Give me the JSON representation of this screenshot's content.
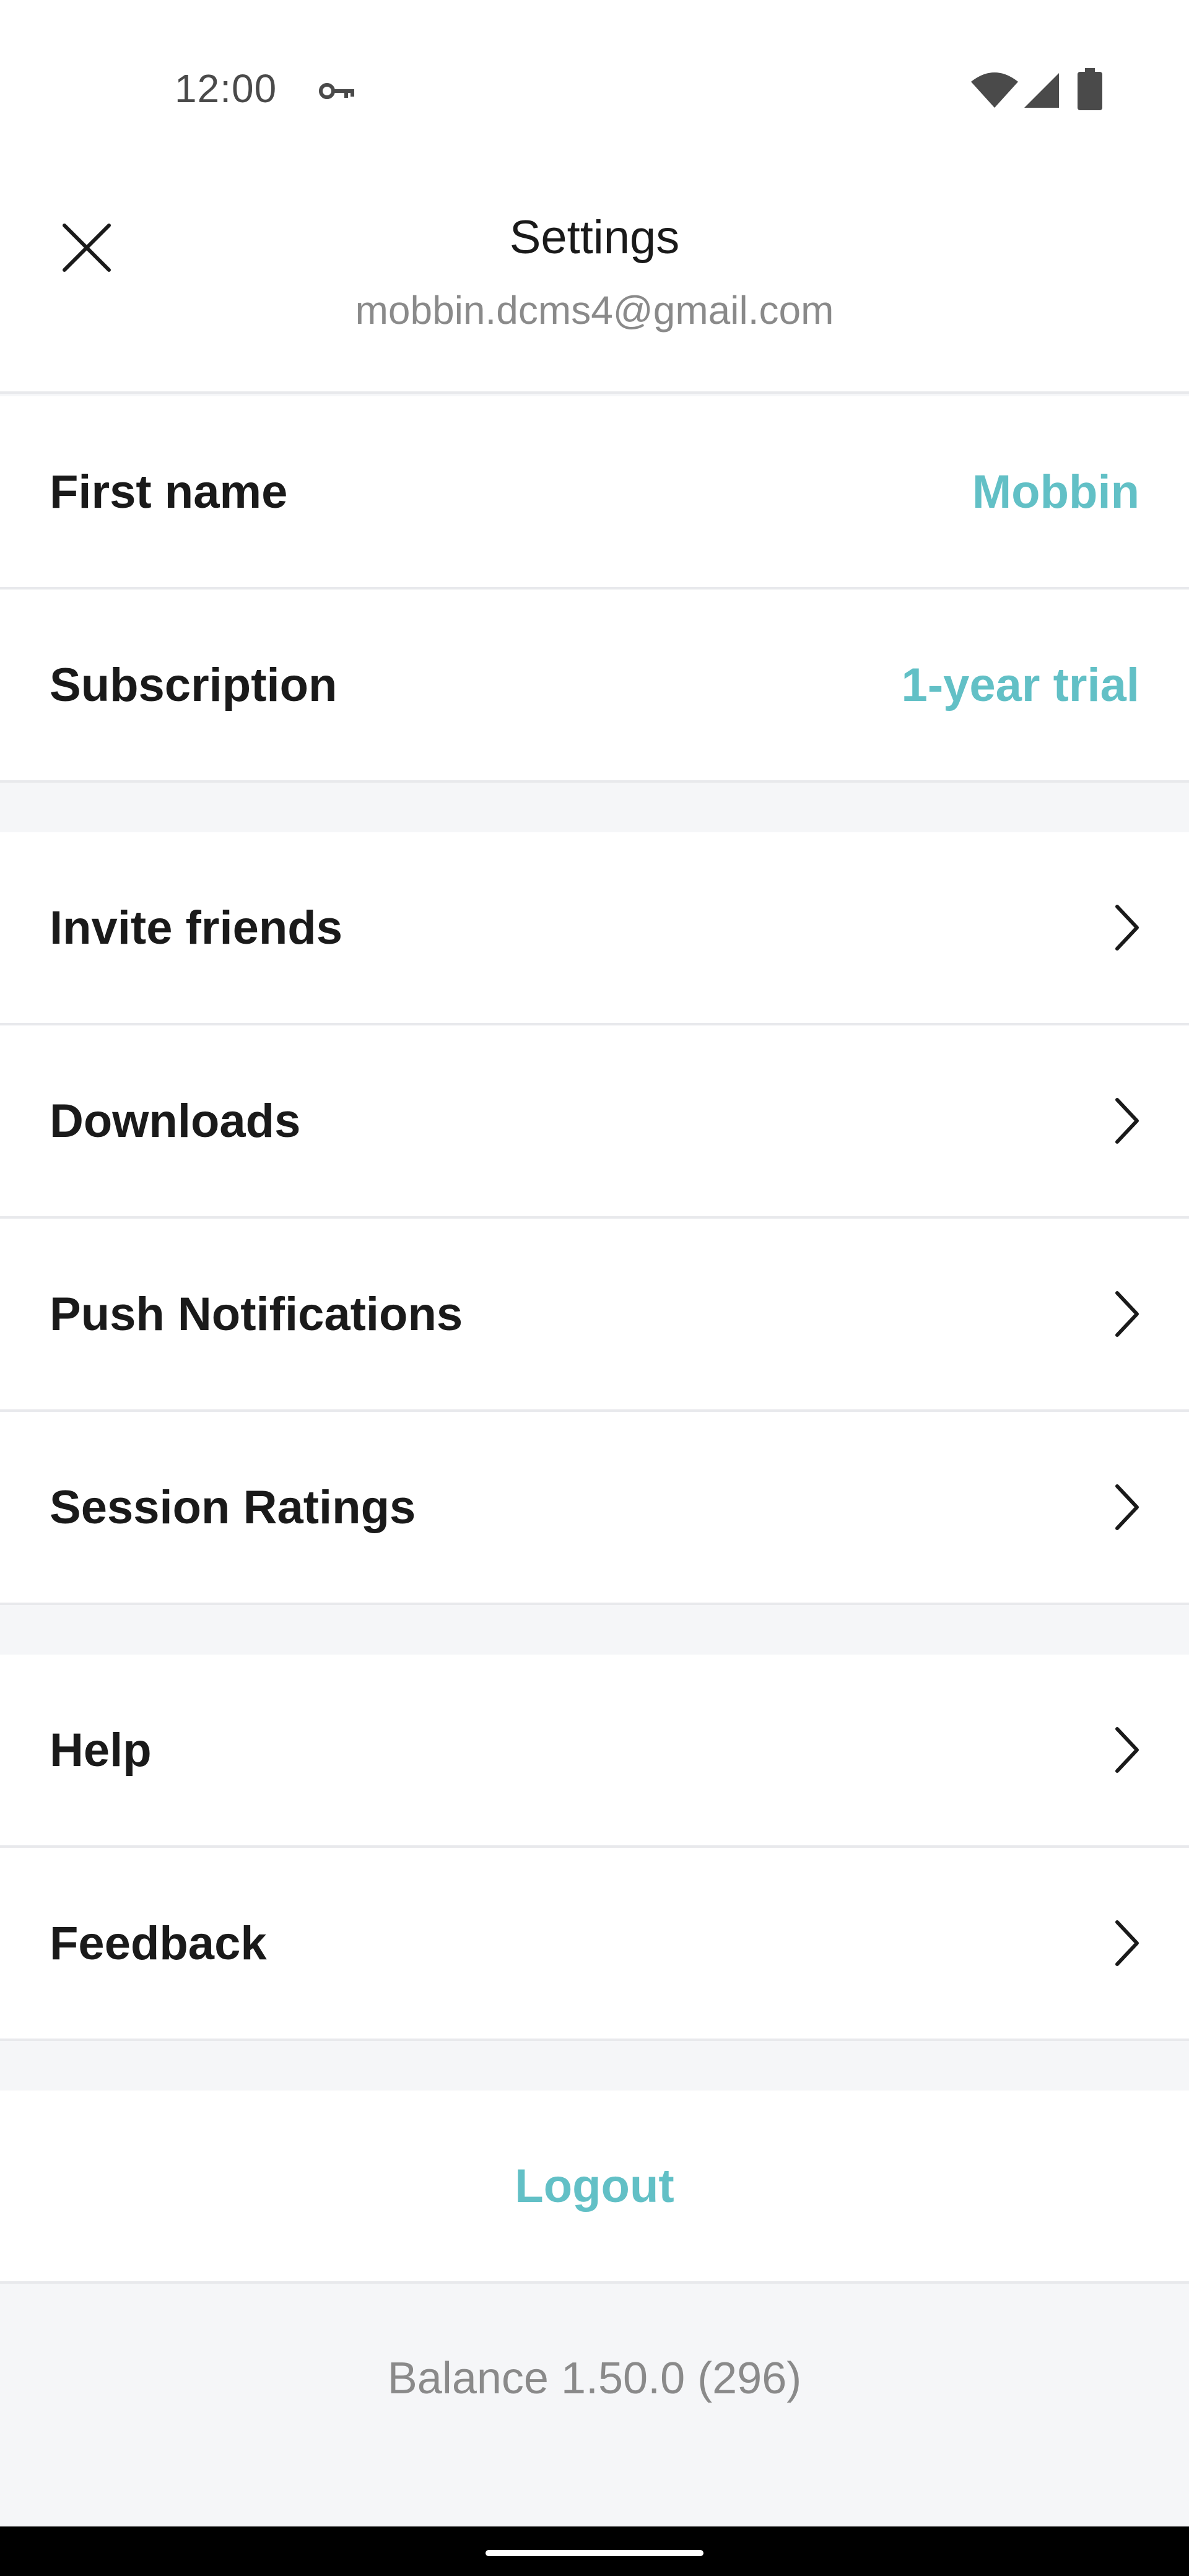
{
  "status_bar": {
    "time": "12:00",
    "icons": [
      "vpn-key-icon",
      "wifi-icon",
      "cell-signal-icon",
      "battery-icon"
    ]
  },
  "header": {
    "title": "Settings",
    "email": "mobbin.dcms4@gmail.com",
    "close_icon": "close-icon"
  },
  "account": {
    "first_name_label": "First name",
    "first_name_value": "Mobbin",
    "subscription_label": "Subscription",
    "subscription_value": "1-year trial"
  },
  "menu_group_1": [
    {
      "label": "Invite friends"
    },
    {
      "label": "Downloads"
    },
    {
      "label": "Push Notifications"
    },
    {
      "label": "Session Ratings"
    }
  ],
  "menu_group_2": [
    {
      "label": "Help"
    },
    {
      "label": "Feedback"
    }
  ],
  "logout_label": "Logout",
  "version_text": "Balance 1.50.0 (296)",
  "colors": {
    "accent": "#62c0c6",
    "text_primary": "#1a1a1a",
    "text_secondary": "#8a8a8a",
    "background": "#f5f6f8",
    "divider": "#e8e9ec"
  }
}
